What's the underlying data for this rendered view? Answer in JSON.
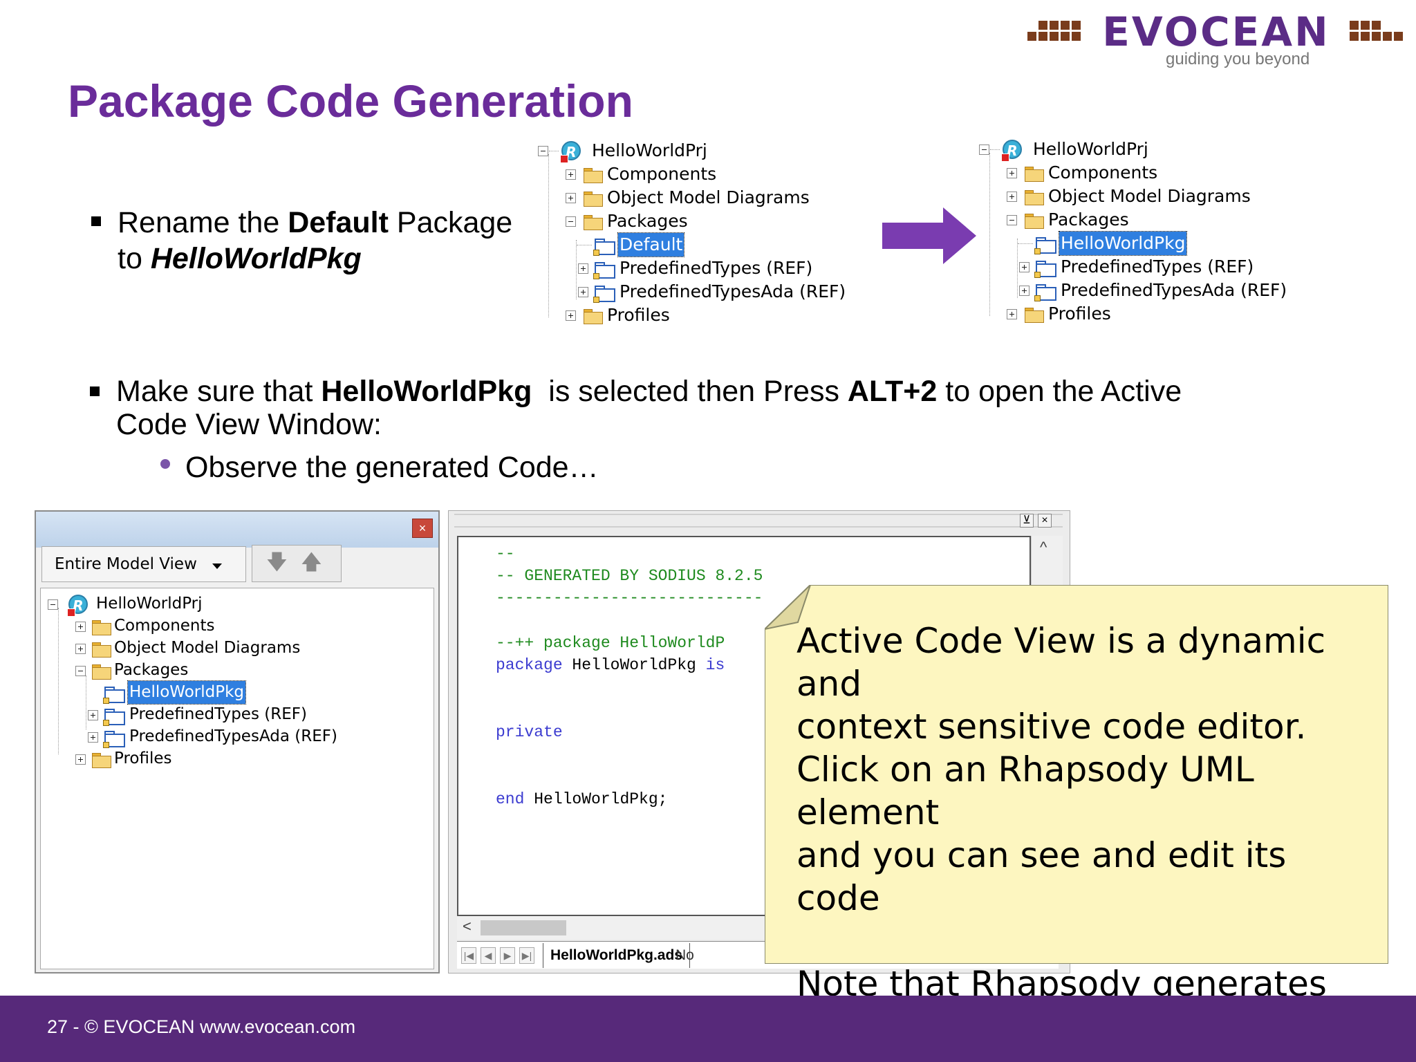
{
  "logo": {
    "brand": "EVOCEAN",
    "tagline": "guiding you beyond"
  },
  "slide": {
    "title": "Package Code Generation",
    "bullet1": {
      "pre": "Rename the ",
      "bold": "Default",
      "mid": " Package",
      "line2_pre": "to ",
      "line2_bold": "HelloWorldPkg"
    },
    "bullet2": {
      "pre": "Make sure that ",
      "bold1": "HelloWorldPkg",
      "mid": "  is selected then Press ",
      "bold2": "ALT+2",
      "post": " to open the Active",
      "line2": "Code View Window:"
    },
    "sub_bullet": "Observe the generated Code…"
  },
  "tree_before": {
    "root": "HelloWorldPrj",
    "items": [
      "Components",
      "Object Model Diagrams",
      "Packages",
      "Default",
      "PredefinedTypes (REF)",
      "PredefinedTypesAda (REF)",
      "Profiles"
    ]
  },
  "tree_after": {
    "root": "HelloWorldPrj",
    "items": [
      "Components",
      "Object Model Diagrams",
      "Packages",
      "HelloWorldPkg",
      "PredefinedTypes (REF)",
      "PredefinedTypesAda (REF)",
      "Profiles"
    ]
  },
  "browser_panel": {
    "close": "×",
    "view_selector": "Entire Model View",
    "nav_down": "🡇",
    "nav_up": "🡅",
    "tree": {
      "root": "HelloWorldPrj",
      "items": [
        "Components",
        "Object Model Diagrams",
        "Packages",
        "HelloWorldPkg",
        "PredefinedTypes (REF)",
        "PredefinedTypesAda (REF)",
        "Profiles"
      ]
    }
  },
  "code_panel": {
    "controls": {
      "pin": "⊻",
      "close": "×"
    },
    "lines": {
      "l1": "--",
      "l2": "-- GENERATED BY SODIUS 8.2.5",
      "l3": "----------------------------",
      "l4": "--++ package HelloWorldP",
      "l5_kw": "package",
      "l5_rest": " HelloWorldPkg ",
      "l5_kw2": "is",
      "l6": "private",
      "l7_kw": "end",
      "l7_rest": " HelloWorldPkg;"
    },
    "scroll_up": "^",
    "scroll_left": "<",
    "tab_nav": [
      "|◀",
      "◀",
      "▶",
      "▶|"
    ],
    "tabs": [
      "HelloWorldPkg.ads",
      "No"
    ]
  },
  "note": {
    "text": "Active Code View is a dynamic and\ncontext sensitive code editor.\nClick on an Rhapsody UML element\nand you can see and edit its code\n\nNote that Rhapsody generates an\nADA Package for a UML Package"
  },
  "footer": {
    "text": "27 - © EVOCEAN www.evocean.com"
  },
  "colors": {
    "title": "#6a2c9a",
    "footer": "#57297a",
    "arrow": "#7a3cb0",
    "note_bg": "#fdf6c0",
    "selection": "#2f7fe0"
  }
}
